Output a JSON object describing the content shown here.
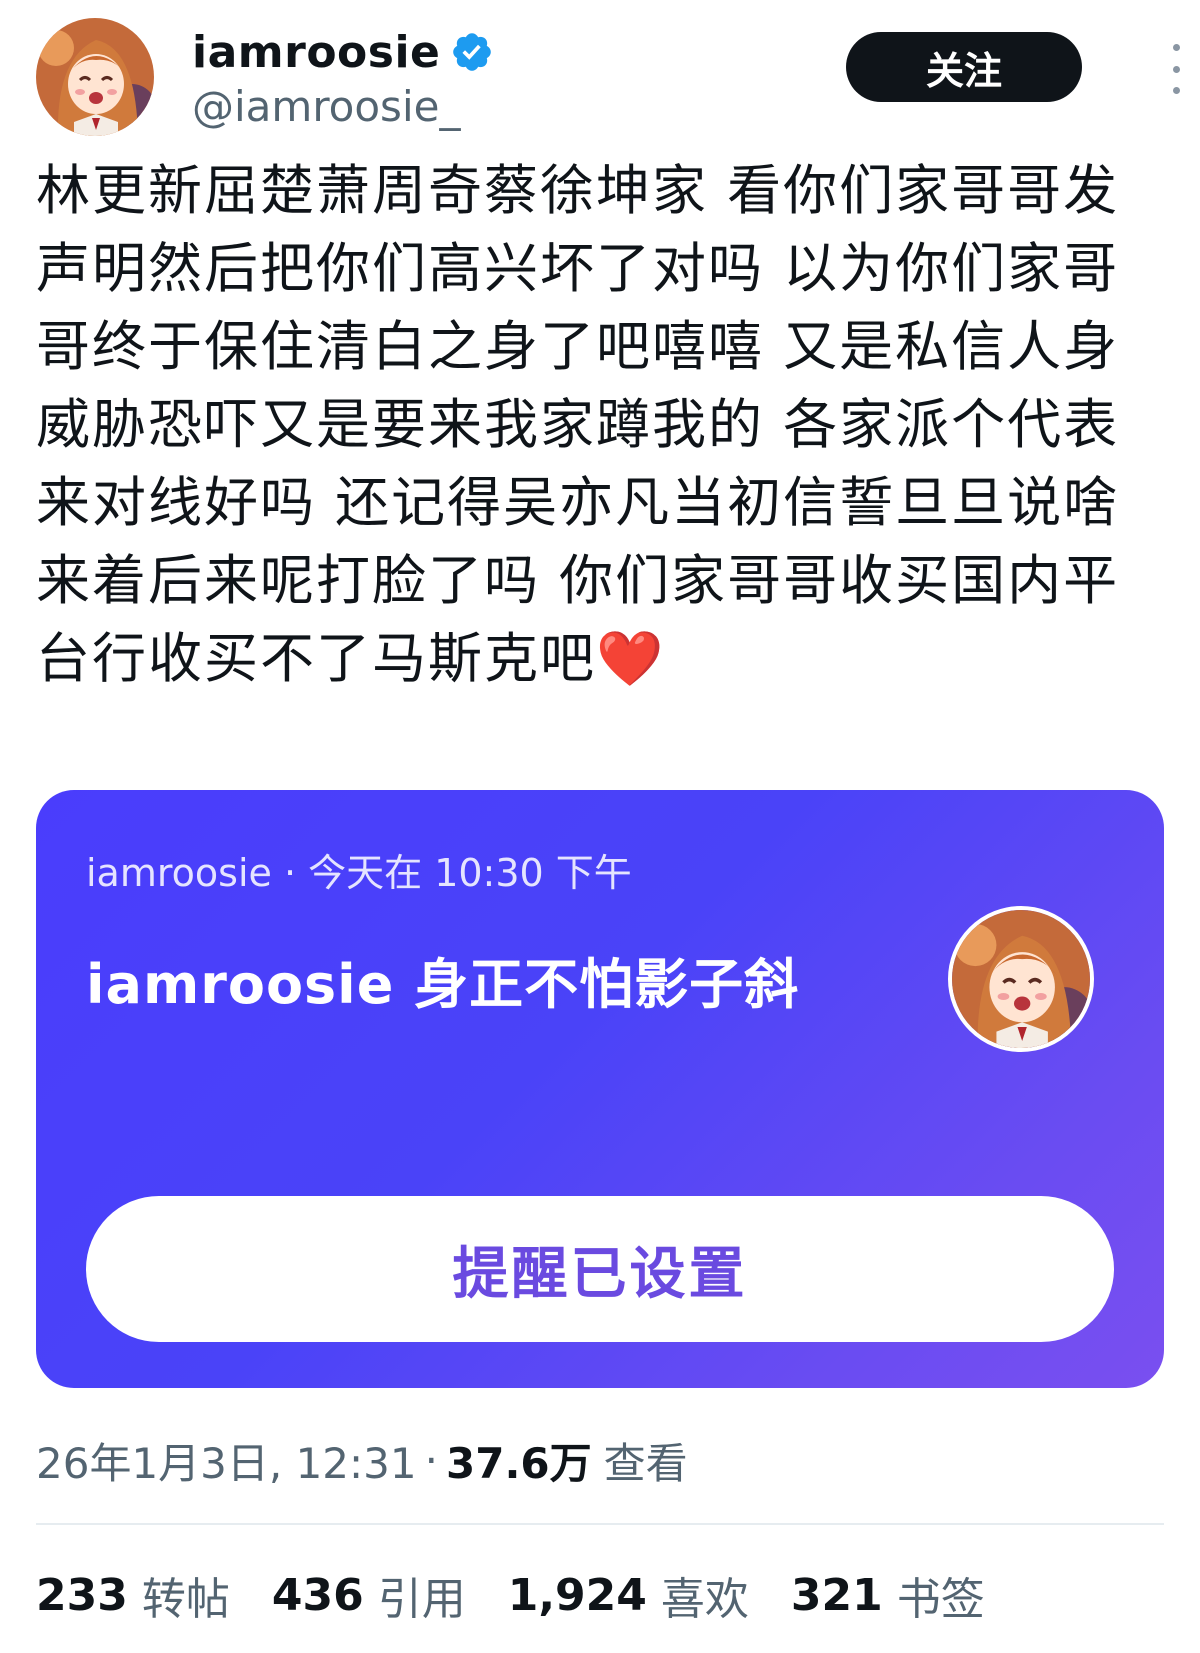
{
  "header": {
    "display_name": "iamroosie",
    "handle": "@iamroosie_",
    "follow_label": "关注",
    "verified_color": "#1d9bf0"
  },
  "tweet": {
    "text": "林更新屈楚萧周奇蔡徐坤家 看你们家哥哥发声明然后把你们高兴坏了对吗 以为你们家哥哥终于保住清白之身了吧嘻嘻 又是私信人身威胁恐吓又是要来我家蹲我的 各家派个代表来对线好吗 还记得吴亦凡当初信誓旦旦说啥来着后来呢打脸了吗 你们家哥哥收买国内平台行收买不了马斯克吧",
    "emoji": "❤️"
  },
  "card": {
    "meta": "iamroosie · 今天在 10:30 下午",
    "title": "iamroosie 身正不怕影子斜",
    "button_label": "提醒已设置",
    "gradient_start": "#4a3dfc",
    "gradient_end": "#7a4ff0"
  },
  "meta": {
    "timestamp": "26年1月3日, 12:31",
    "separator": "·",
    "views_count": "37.6万",
    "views_label": "查看"
  },
  "stats": {
    "reposts": {
      "count": "233",
      "label": "转帖"
    },
    "quotes": {
      "count": "436",
      "label": "引用"
    },
    "likes": {
      "count": "1,924",
      "label": "喜欢"
    },
    "bookmarks": {
      "count": "321",
      "label": "书签"
    }
  }
}
